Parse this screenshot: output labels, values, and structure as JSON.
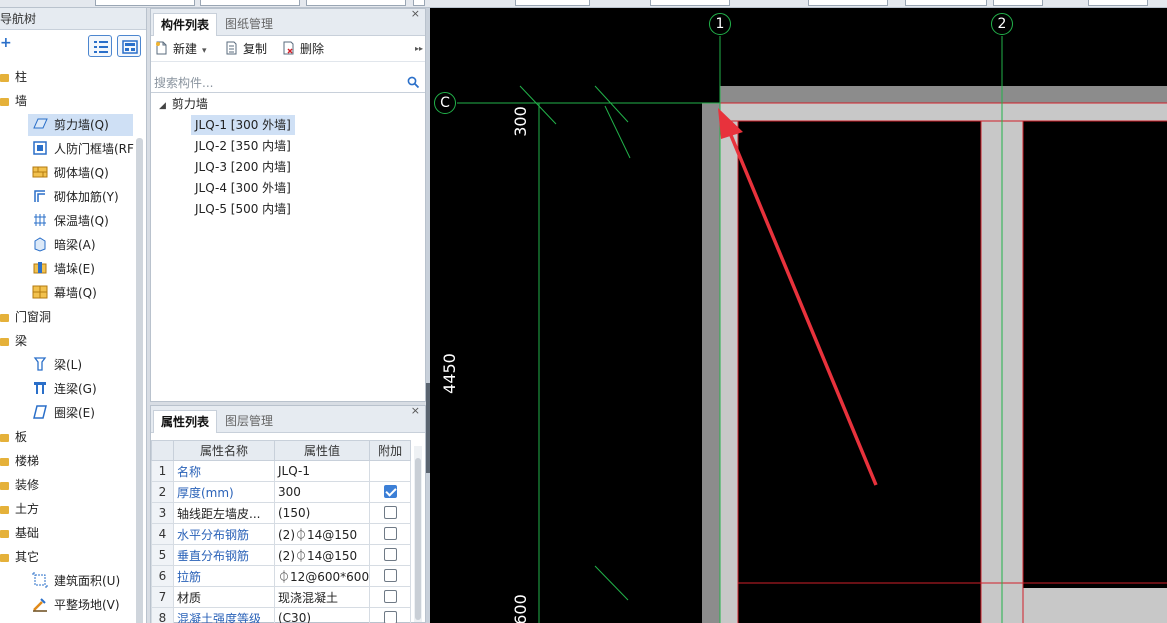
{
  "nav": {
    "header": "导航树",
    "plus": "+",
    "items": [
      {
        "label": "柱",
        "type": "folder"
      },
      {
        "label": "墙",
        "type": "folder"
      },
      {
        "label": "剪力墙(Q)",
        "type": "child",
        "icon": "shear-wall-icon",
        "selected": true
      },
      {
        "label": "人防门框墙(RF",
        "type": "child",
        "icon": "door-frame-wall-icon"
      },
      {
        "label": "砌体墙(Q)",
        "type": "child",
        "icon": "masonry-wall-icon"
      },
      {
        "label": "砌体加筋(Y)",
        "type": "child",
        "icon": "masonry-rebar-icon"
      },
      {
        "label": "保温墙(Q)",
        "type": "child",
        "icon": "insulation-wall-icon"
      },
      {
        "label": "暗梁(A)",
        "type": "child",
        "icon": "hidden-beam-icon"
      },
      {
        "label": "墙垛(E)",
        "type": "child",
        "icon": "wall-pier-icon"
      },
      {
        "label": "幕墙(Q)",
        "type": "child",
        "icon": "curtain-wall-icon"
      },
      {
        "label": "门窗洞",
        "type": "folder"
      },
      {
        "label": "梁",
        "type": "folder"
      },
      {
        "label": "梁(L)",
        "type": "child",
        "icon": "beam-icon"
      },
      {
        "label": "连梁(G)",
        "type": "child",
        "icon": "coupling-beam-icon"
      },
      {
        "label": "圈梁(E)",
        "type": "child",
        "icon": "ring-beam-icon"
      },
      {
        "label": "板",
        "type": "folder"
      },
      {
        "label": "楼梯",
        "type": "folder"
      },
      {
        "label": "装修",
        "type": "folder"
      },
      {
        "label": "土方",
        "type": "folder"
      },
      {
        "label": "基础",
        "type": "folder"
      },
      {
        "label": "其它",
        "type": "folder"
      },
      {
        "label": "建筑面积(U)",
        "type": "child",
        "icon": "building-area-icon"
      },
      {
        "label": "平整场地(V)",
        "type": "child",
        "icon": "site-leveling-icon"
      }
    ]
  },
  "component_panel": {
    "tabs": [
      "构件列表",
      "图纸管理"
    ],
    "close": "×",
    "toolbar": {
      "new": "新建",
      "copy": "复制",
      "delete": "删除",
      "more": "▸▸"
    },
    "search_placeholder": "搜索构件...",
    "group": "剪力墙",
    "items": [
      {
        "label": "JLQ-1 [300 外墙]",
        "selected": true
      },
      {
        "label": "JLQ-2 [350 内墙]",
        "selected": false
      },
      {
        "label": "JLQ-3 [200 内墙]",
        "selected": false
      },
      {
        "label": "JLQ-4 [300 外墙]",
        "selected": false
      },
      {
        "label": "JLQ-5 [500 内墙]",
        "selected": false
      }
    ]
  },
  "property_panel": {
    "tabs": [
      "属性列表",
      "图层管理"
    ],
    "close": "×",
    "columns": [
      "属性名称",
      "属性值",
      "附加"
    ],
    "rows": [
      {
        "no": "1",
        "name": "名称",
        "value": "JLQ-1",
        "blue": true,
        "checkbox": null
      },
      {
        "no": "2",
        "name": "厚度(mm)",
        "value": "300",
        "blue": true,
        "checkbox": true
      },
      {
        "no": "3",
        "name": "轴线距左墙皮...",
        "value": "(150)",
        "blue": false,
        "checkbox": false
      },
      {
        "no": "4",
        "name": "水平分布钢筋",
        "value": "(2)⏀14@150",
        "blue": true,
        "checkbox": false
      },
      {
        "no": "5",
        "name": "垂直分布钢筋",
        "value": "(2)⏀14@150",
        "blue": true,
        "checkbox": false
      },
      {
        "no": "6",
        "name": "拉筋",
        "value": "⏀12@600*600",
        "blue": true,
        "checkbox": false
      },
      {
        "no": "7",
        "name": "材质",
        "value": "现浇混凝土",
        "blue": false,
        "checkbox": false
      },
      {
        "no": "8",
        "name": "混凝土强度等级",
        "value": "(C30)",
        "blue": true,
        "checkbox": false
      }
    ]
  },
  "canvas": {
    "axis_labels": [
      "1",
      "2",
      "C"
    ],
    "dimensions": [
      "300",
      "4450",
      "600"
    ],
    "colors": {
      "background": "#000000",
      "axis": "#22b24a",
      "wall": "#8c8c8c",
      "wall_light": "#c8c8c8",
      "edge": "#d0202a",
      "arrow": "#e8323c"
    }
  }
}
